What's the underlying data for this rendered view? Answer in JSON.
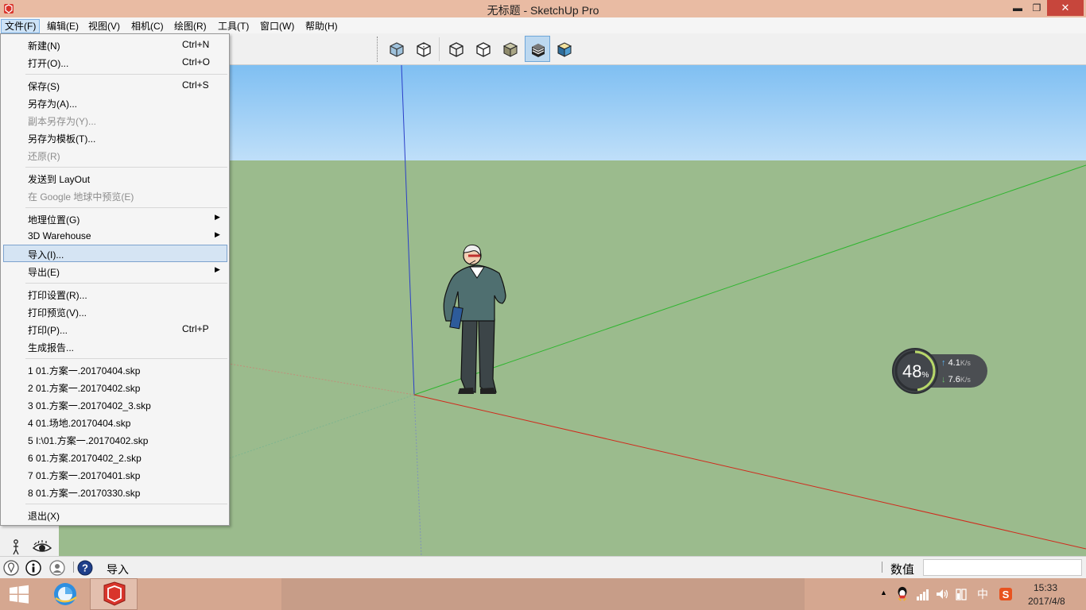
{
  "window": {
    "title": "无标题 - SketchUp Pro",
    "minimize": "▬",
    "maximize": "❐",
    "close": "✕"
  },
  "menubar": {
    "items": [
      {
        "label": "文件(F)",
        "active": true
      },
      {
        "label": "编辑(E)"
      },
      {
        "label": "视图(V)"
      },
      {
        "label": "相机(C)"
      },
      {
        "label": "绘图(R)"
      },
      {
        "label": "工具(T)"
      },
      {
        "label": "窗口(W)"
      },
      {
        "label": "帮助(H)"
      }
    ]
  },
  "toolbar": {
    "buttons": [
      {
        "icon": "xray-style-icon"
      },
      {
        "icon": "back-edges-style-icon"
      },
      {
        "icon": "wireframe-style-icon"
      },
      {
        "icon": "hidden-line-style-icon"
      },
      {
        "icon": "shaded-style-icon"
      },
      {
        "icon": "shaded-with-textures-style-icon",
        "pressed": true
      },
      {
        "icon": "monochrome-style-icon"
      }
    ]
  },
  "file_menu": {
    "items": [
      {
        "label": "新建(N)",
        "shortcut": "Ctrl+N"
      },
      {
        "label": "打开(O)...",
        "shortcut": "Ctrl+O"
      },
      {
        "label": "保存(S)",
        "shortcut": "Ctrl+S"
      },
      {
        "label": "另存为(A)..."
      },
      {
        "label": "副本另存为(Y)...",
        "disabled": true
      },
      {
        "label": "另存为模板(T)..."
      },
      {
        "label": "还原(R)",
        "disabled": true
      },
      {
        "label": "发送到 LayOut"
      },
      {
        "label": "在 Google 地球中预览(E)",
        "disabled": true
      },
      {
        "label": "地理位置(G)",
        "submenu": true
      },
      {
        "label": "3D Warehouse",
        "submenu": true
      },
      {
        "label": "导入(I)...",
        "highlighted": true
      },
      {
        "label": "导出(E)",
        "submenu": true
      },
      {
        "label": "打印设置(R)..."
      },
      {
        "label": "打印预览(V)..."
      },
      {
        "label": "打印(P)...",
        "shortcut": "Ctrl+P"
      },
      {
        "label": "生成报告..."
      },
      {
        "label": "1 01.方案一.20170404.skp"
      },
      {
        "label": "2 01.方案一.20170402.skp"
      },
      {
        "label": "3 01.方案一.20170402_3.skp"
      },
      {
        "label": "4 01.场地.20170404.skp"
      },
      {
        "label": "5 I:\\01.方案一.20170402.skp"
      },
      {
        "label": "6 01.方案.20170402_2.skp"
      },
      {
        "label": "7 01.方案一.20170401.skp"
      },
      {
        "label": "8 01.方案一.20170330.skp"
      },
      {
        "label": "退出(X)"
      }
    ]
  },
  "net_monitor": {
    "percent": "48",
    "percent_unit": "%",
    "up_arrow": "↑",
    "up_speed": "4.1",
    "down_arrow": "↓",
    "down_speed": "7.6",
    "unit": "K/s"
  },
  "statusbar": {
    "hint": "导入",
    "measurements_label": "数值",
    "measurements_value": ""
  },
  "taskbar": {
    "ime": "中",
    "time": "15:33",
    "date": "2017/4/8"
  },
  "colors": {
    "sky_top": "#7fbff2",
    "ground": "#9bbb8d",
    "axis_red": "#d02a1c",
    "axis_green": "#2fb52f",
    "axis_blue": "#2a3fc8",
    "title_bar": "#e9bba3",
    "close_button": "#c7463c",
    "menu_highlight": "#d5e4f3"
  }
}
